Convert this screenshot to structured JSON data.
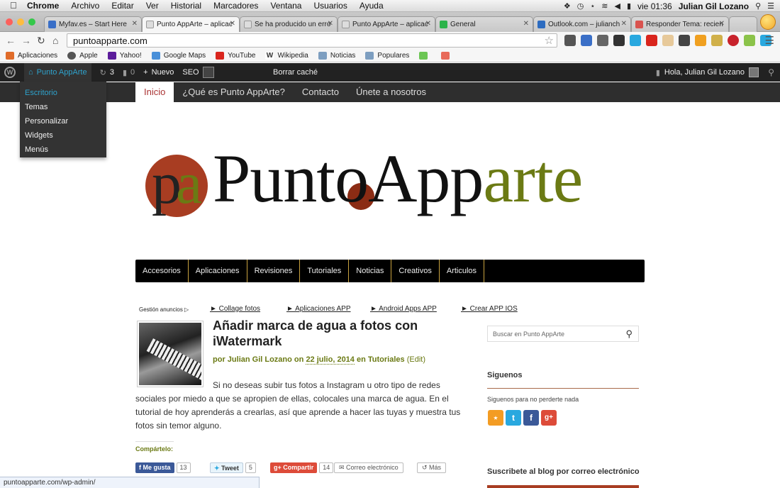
{
  "mac_menu": {
    "app": "Chrome",
    "items": [
      "Archivo",
      "Editar",
      "Ver",
      "Historial",
      "Marcadores",
      "Ventana",
      "Usuarios",
      "Ayuda"
    ],
    "clock": "vie 01:36",
    "user": "Julian Gil Lozano"
  },
  "tabs": [
    {
      "label": "Myfav.es – Start Here",
      "color": "#3a6fc7"
    },
    {
      "label": "Punto AppArte – aplicac",
      "color": "#dddddd"
    },
    {
      "label": "Se ha producido un erro",
      "color": "#dddddd"
    },
    {
      "label": "Punto AppArte – aplicac",
      "color": "#dddddd"
    },
    {
      "label": "General",
      "color": "#2cb34a"
    },
    {
      "label": "Outlook.com – julianch",
      "color": "#2d6cc0"
    },
    {
      "label": "Responder Tema: recien",
      "color": "#d9534f"
    }
  ],
  "omnibox": {
    "url": "puntoapparte.com"
  },
  "bookmarks": [
    {
      "label": "Aplicaciones",
      "color": "#e06c2a"
    },
    {
      "label": "Apple",
      "color": "#555555"
    },
    {
      "label": "Yahoo!",
      "color": "#5c1d9b"
    },
    {
      "label": "Google Maps",
      "color": "#4a90d9"
    },
    {
      "label": "YouTube",
      "color": "#d9251d"
    },
    {
      "label": "Wikipedia",
      "color": "#777777"
    },
    {
      "label": "Noticias",
      "color": "#7d9ec0"
    },
    {
      "label": "Populares",
      "color": "#7d9ec0"
    }
  ],
  "wp_admin": {
    "site_name": "Punto AppArte",
    "updates": "3",
    "comments": "0",
    "new_label": "Nuevo",
    "seo": "SEO",
    "clear_cache": "Borrar caché",
    "howdy": "Hola, Julian Gil Lozano",
    "dropdown": [
      "Escritorio",
      "Temas",
      "Personalizar",
      "Widgets",
      "Menús"
    ]
  },
  "site_nav": [
    "Inicio",
    "¿Qué es Punto AppArte?",
    "Contacto",
    "Únete a nosotros"
  ],
  "logo": {
    "first": "Punt",
    "o": "o",
    "mid": "App",
    "end": "arte"
  },
  "categories": [
    "Accesorios",
    "Aplicaciones",
    "Revisiones",
    "Tutoriales",
    "Noticias",
    "Creativos",
    "Articulos"
  ],
  "ads": {
    "label": "Gestión anuncios",
    "links": [
      "► Collage fotos",
      "► Aplicaciones APP",
      "► Android Apps APP",
      "► Crear APP IOS"
    ]
  },
  "post": {
    "title": "Añadir marca de agua a fotos con iWatermark",
    "by": "por",
    "author": "Julian Gil Lozano",
    "on": "on",
    "date": "22 julio, 2014",
    "in": "en",
    "category": "Tutoriales",
    "edit": "(Edit)",
    "excerpt": "Si no deseas subir tus fotos a Instagram u otro tipo de redes sociales por miedo a que se apropien de ellas, colocales una marca de agua. En el tutorial de hoy aprenderás a crearlas, así que aprende a hacer las tuyas y muestra tus fotos sin temor alguno."
  },
  "share": {
    "label": "Compártelo:",
    "facebook": "Me gusta",
    "facebook_count": "13",
    "twitter": "Tweet",
    "twitter_count": "5",
    "gplus": "Compartir",
    "gplus_count": "14",
    "email": "Correo electrónico",
    "more": "Más"
  },
  "sidebar": {
    "search_placeholder": "Buscar en Punto AppArte",
    "follow_heading": "Siguenos",
    "follow_text": "Siguenos para no perderte nada",
    "subscribe_heading": "Suscribete al blog por correo electrónico"
  },
  "status_url": "puntoapparte.com/wp-admin/",
  "colors": {
    "accent_green": "#6b7a14",
    "accent_red": "#a83d22",
    "wp_blue": "#2ea2cc"
  }
}
